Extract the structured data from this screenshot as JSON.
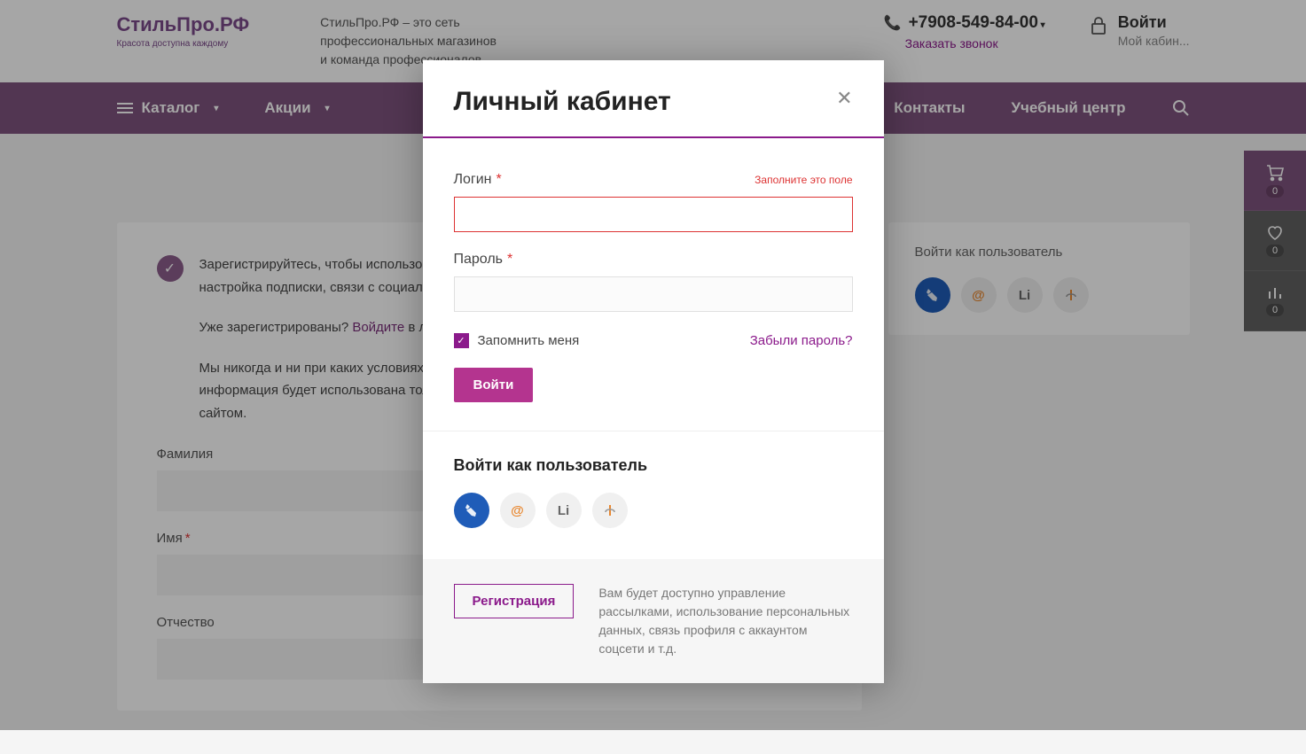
{
  "header": {
    "logo_main": "СтильПро.РФ",
    "logo_sub": "Красота доступна каждому",
    "tagline": "СтильПро.РФ – это сеть профессиональных магазинов и команда профессионалов",
    "phone": "+7908-549-84-00",
    "callback": "Заказать звонок",
    "login": "Войти",
    "cabinet": "Мой кабин..."
  },
  "nav": {
    "catalog": "Каталог",
    "promo": "Акции",
    "contacts": "Контакты",
    "center": "Учебный центр"
  },
  "main": {
    "info1": "Зарегистрируйтесь, чтобы использовать все возможности личного кабинета: отслеживание заказов, настройка подписки, связи с социальными сетями и другое.",
    "info2_prefix": "Уже зарегистрированы? ",
    "info2_link": "Войдите",
    "info2_suffix": " в личный кабинет.",
    "info3": "Мы никогда и ни при каких условиях не разглашаем личные данные клиентов. Контактная информация будет использована только для оформления заказов и более удобной работы с сайтом.",
    "label_lastname": "Фамилия",
    "label_firstname": "Имя",
    "label_middlename": "Отчество",
    "side_title": "Войти как пользователь",
    "social_li": "Li"
  },
  "widget": {
    "cart_count": "0",
    "fav_count": "0",
    "compare_count": "0"
  },
  "modal": {
    "title": "Личный кабинет",
    "label_login": "Логин",
    "error_login": "Заполните это поле",
    "label_password": "Пароль",
    "remember": "Запомнить меня",
    "forgot": "Забыли пароль?",
    "submit": "Войти",
    "social_title": "Войти как пользователь",
    "social_li": "Li",
    "reg_button": "Регистрация",
    "footer_text": "Вам будет доступно управление рассылками, использование персональных данных, связь профиля с аккаунтом соцсети и т.д."
  }
}
